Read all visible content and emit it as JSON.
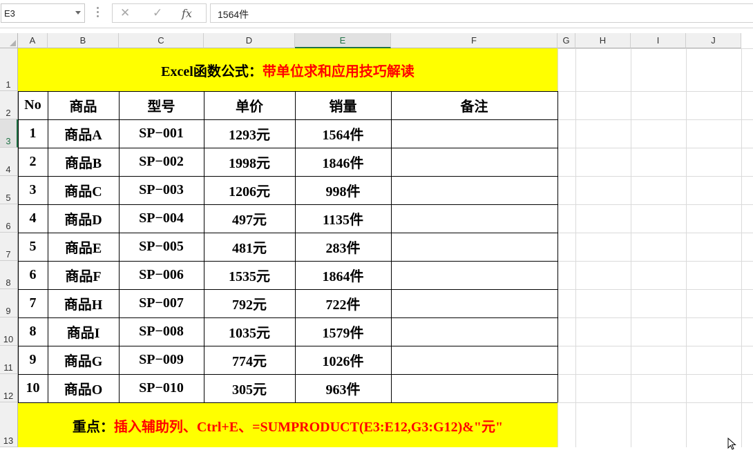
{
  "formula_bar": {
    "name_box": "E3",
    "cancel_icon": "✕",
    "enter_icon": "✓",
    "fx_icon": "fx",
    "formula": "1564件"
  },
  "columns": [
    "A",
    "B",
    "C",
    "D",
    "E",
    "F",
    "G",
    "H",
    "I",
    "J"
  ],
  "rows": [
    "1",
    "2",
    "3",
    "4",
    "5",
    "6",
    "7",
    "8",
    "9",
    "10",
    "11",
    "12",
    "13"
  ],
  "title": {
    "part1": "Excel函数公式：",
    "part2": "带单位求和应用技巧解读"
  },
  "table": {
    "headers": [
      "No",
      "商品",
      "型号",
      "单价",
      "销量",
      "备注"
    ],
    "rows": [
      [
        "1",
        "商品A",
        "SP−001",
        "1293元",
        "1564件",
        ""
      ],
      [
        "2",
        "商品B",
        "SP−002",
        "1998元",
        "1846件",
        ""
      ],
      [
        "3",
        "商品C",
        "SP−003",
        "1206元",
        "998件",
        ""
      ],
      [
        "4",
        "商品D",
        "SP−004",
        "497元",
        "1135件",
        ""
      ],
      [
        "5",
        "商品E",
        "SP−005",
        "481元",
        "283件",
        ""
      ],
      [
        "6",
        "商品F",
        "SP−006",
        "1535元",
        "1864件",
        ""
      ],
      [
        "7",
        "商品H",
        "SP−007",
        "792元",
        "722件",
        ""
      ],
      [
        "8",
        "商品I",
        "SP−008",
        "1035元",
        "1579件",
        ""
      ],
      [
        "9",
        "商品G",
        "SP−009",
        "774元",
        "1026件",
        ""
      ],
      [
        "10",
        "商品O",
        "SP−010",
        "305元",
        "963件",
        ""
      ]
    ]
  },
  "footer": {
    "part1": "重点：",
    "part2": "插入辅助列、Ctrl+E、=SUMPRODUCT(E3:E12,G3:G12)&\"元\""
  },
  "selected_cell": "E3",
  "colors": {
    "highlight": "#ffff00",
    "accent_red": "#ff0000",
    "selection": "#217346"
  }
}
